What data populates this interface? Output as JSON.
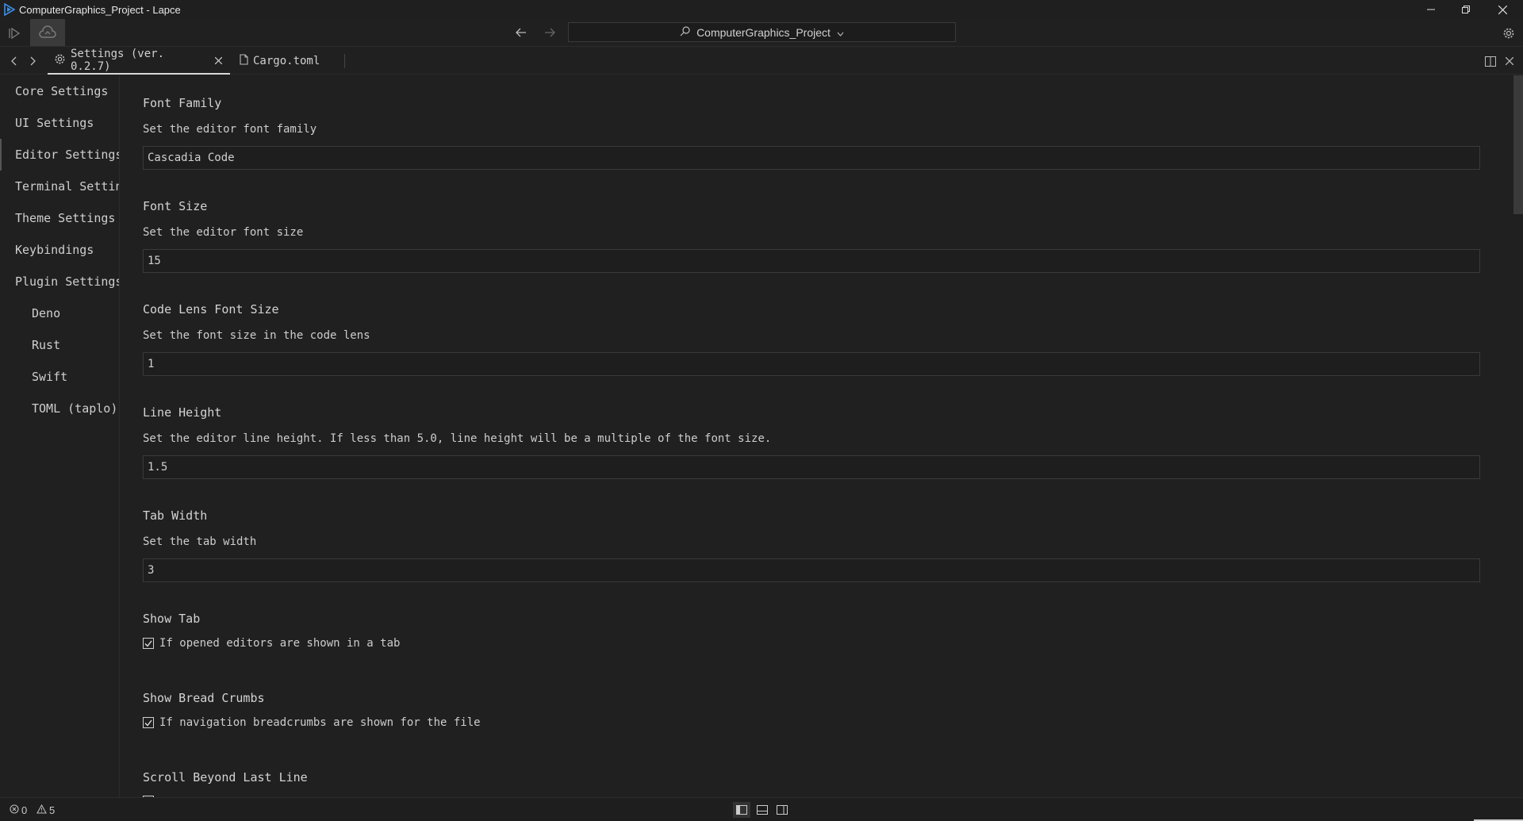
{
  "window": {
    "title": "ComputerGraphics_Project - Lapce"
  },
  "toolbar": {
    "palette_label": "ComputerGraphics_Project"
  },
  "tabs": [
    {
      "label": "Settings (ver. 0.2.7)",
      "icon": "gear-icon",
      "active": true
    },
    {
      "label": "Cargo.toml",
      "icon": "file-icon",
      "active": false
    }
  ],
  "sidebar": {
    "items": [
      {
        "label": "Core Settings"
      },
      {
        "label": "UI Settings"
      },
      {
        "label": "Editor Settings"
      },
      {
        "label": "Terminal Settings"
      },
      {
        "label": "Theme Settings"
      },
      {
        "label": "Keybindings"
      },
      {
        "label": "Plugin Settings"
      }
    ],
    "plugins": [
      {
        "label": "Deno"
      },
      {
        "label": "Rust"
      },
      {
        "label": "Swift"
      },
      {
        "label": "TOML (taplo)"
      }
    ]
  },
  "settings": {
    "font_family": {
      "title": "Font Family",
      "desc": "Set the editor font family",
      "value": "Cascadia Code"
    },
    "font_size": {
      "title": "Font Size",
      "desc": "Set the editor font size",
      "value": "15"
    },
    "code_lens_font_size": {
      "title": "Code Lens Font Size",
      "desc": "Set the font size in the code lens",
      "value": "1"
    },
    "line_height": {
      "title": "Line Height",
      "desc": "Set the editor line height. If less than 5.0, line height will be a multiple of the font size.",
      "value": "1.5"
    },
    "tab_width": {
      "title": "Tab Width",
      "desc": "Set the tab width",
      "value": "3"
    },
    "show_tab": {
      "title": "Show Tab",
      "desc": "If opened editors are shown in a tab",
      "checked": true
    },
    "show_bread_crumbs": {
      "title": "Show Bread Crumbs",
      "desc": "If navigation breadcrumbs are shown for the file",
      "checked": true
    },
    "scroll_beyond_last_line": {
      "title": "Scroll Beyond Last Line"
    }
  },
  "status": {
    "errors": "0",
    "warnings": "5"
  },
  "colors": {
    "background": "#202020",
    "accent": "#4a90d9"
  }
}
